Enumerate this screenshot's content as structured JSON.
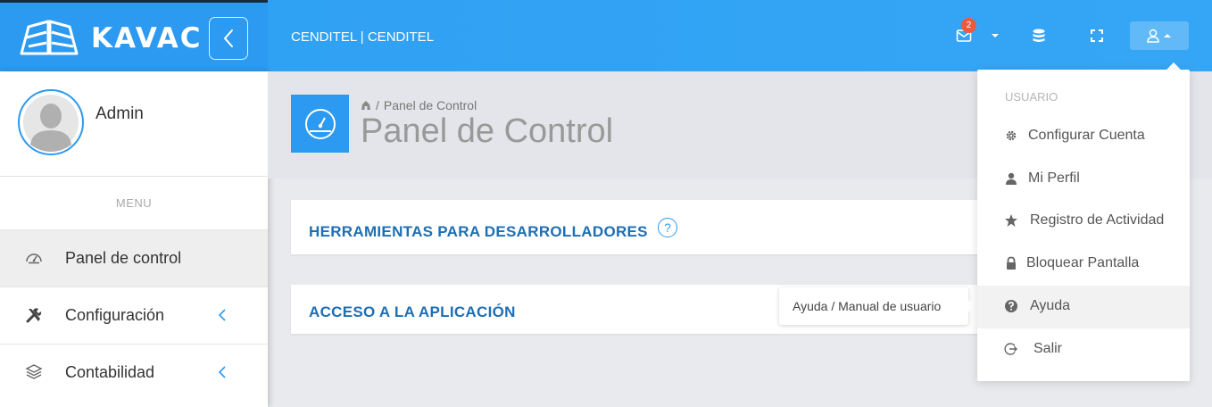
{
  "brand": {
    "name": "KAVAC"
  },
  "topbar": {
    "org": "CENDITEL | CENDITEL",
    "notifications_count": "2",
    "icons": [
      "mail-icon",
      "caret-down-icon",
      "database-icon",
      "fullscreen-icon",
      "user-icon"
    ]
  },
  "sidebar": {
    "user_name": "Admin",
    "menu_header": "MENU",
    "items": [
      {
        "label": "Panel de control",
        "icon": "dashboard-icon",
        "active": true
      },
      {
        "label": "Configuración",
        "icon": "tools-icon",
        "has_submenu": true
      },
      {
        "label": "Contabilidad",
        "icon": "layers-icon",
        "has_submenu": true
      }
    ]
  },
  "main": {
    "breadcrumb": [
      "Panel de Control"
    ],
    "title": "Panel de Control",
    "cards": [
      {
        "title": "HERRAMIENTAS PARA DESARROLLADORES",
        "help": "?"
      },
      {
        "title": "ACCESO A LA APLICACIÓN"
      }
    ]
  },
  "user_menu": {
    "header": "USUARIO",
    "items": [
      {
        "label": "Configurar Cuenta",
        "icon": "gear-icon"
      },
      {
        "label": "Mi Perfil",
        "icon": "person-icon"
      },
      {
        "label": "Registro de Actividad",
        "icon": "star-icon"
      },
      {
        "label": "Bloquear Pantalla",
        "icon": "lock-icon"
      },
      {
        "label": "Ayuda",
        "icon": "question-icon",
        "hover": true
      },
      {
        "label": "Salir",
        "icon": "logout-icon"
      }
    ]
  },
  "tooltip": {
    "text": "Ayuda / Manual de usuario"
  },
  "colors": {
    "primary": "#2b9af0",
    "card_title": "#1d6fb4",
    "badge": "#ef5a3c"
  }
}
